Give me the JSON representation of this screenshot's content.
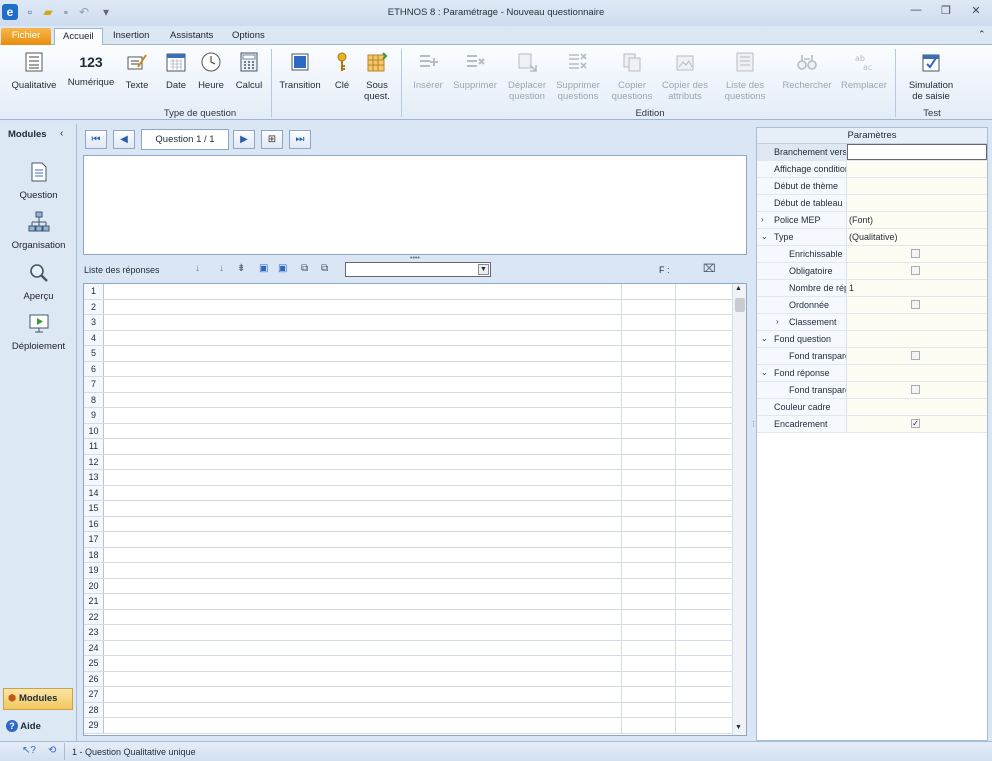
{
  "title": "ETHNOS 8 : Paramétrage - Nouveau questionnaire",
  "tabs": {
    "fichier": "Fichier",
    "accueil": "Accueil",
    "insertion": "Insertion",
    "assistants": "Assistants",
    "options": "Options"
  },
  "ribbon": {
    "qualitative": "Qualitative",
    "numerique": "Numérique",
    "texte": "Texte",
    "date": "Date",
    "heure": "Heure",
    "calcul": "Calcul",
    "transition": "Transition",
    "cle": "Clé",
    "sous1": "Sous",
    "sous2": "quest.",
    "inserer": "Insérer",
    "supprimer": "Supprimer",
    "deplacer1": "Déplacer",
    "deplacer2": "question",
    "supq1": "Supprimer",
    "supq2": "questions",
    "copq1": "Copier",
    "copq2": "questions",
    "copa1": "Copier des",
    "copa2": "attributs",
    "liste1": "Liste des",
    "liste2": "questions",
    "rechercher": "Rechercher",
    "remplacer": "Remplacer",
    "sim1": "Simulation",
    "sim2": "de saisie",
    "group_type": "Type de question",
    "group_edition": "Edition",
    "group_test": "Test",
    "icon_number": "123"
  },
  "left": {
    "modules": "Modules",
    "question": "Question",
    "organisation": "Organisation",
    "apercu": "Aperçu",
    "deploiement": "Déploiement",
    "modules_btn": "Modules",
    "aide": "Aide"
  },
  "content": {
    "question_box": "Question 1 / 1",
    "list_label": "Liste des réponses",
    "f_label": "F :"
  },
  "rows": [
    1,
    2,
    3,
    4,
    5,
    6,
    7,
    8,
    9,
    10,
    11,
    12,
    13,
    14,
    15,
    16,
    17,
    18,
    19,
    20,
    21,
    22,
    23,
    24,
    25,
    26,
    27,
    28,
    29
  ],
  "props": {
    "header": "Paramètres",
    "branchement": "Branchement vers",
    "affichage": "Affichage conditior",
    "debut_theme": "Début de thème",
    "debut_tableau": "Début de tableau",
    "police": "Police MEP",
    "police_val": "(Font)",
    "type": "Type",
    "type_val": "(Qualitative)",
    "enrichissable": "Enrichissable",
    "obligatoire": "Obligatoire",
    "nombre": "Nombre de rép",
    "nombre_val": "1",
    "ordonnee": "Ordonnée",
    "classement": "Classement",
    "fond_question": "Fond question",
    "fond_transp1": "Fond transpare",
    "fond_reponse": "Fond réponse",
    "fond_transp2": "Fond transpare",
    "couleur": "Couleur cadre",
    "encadrement": "Encadrement"
  },
  "status": {
    "text": "1 - Question Qualitative  unique"
  },
  "colors": {
    "accent": "#e88d0e",
    "brand": "#2a5db0"
  }
}
